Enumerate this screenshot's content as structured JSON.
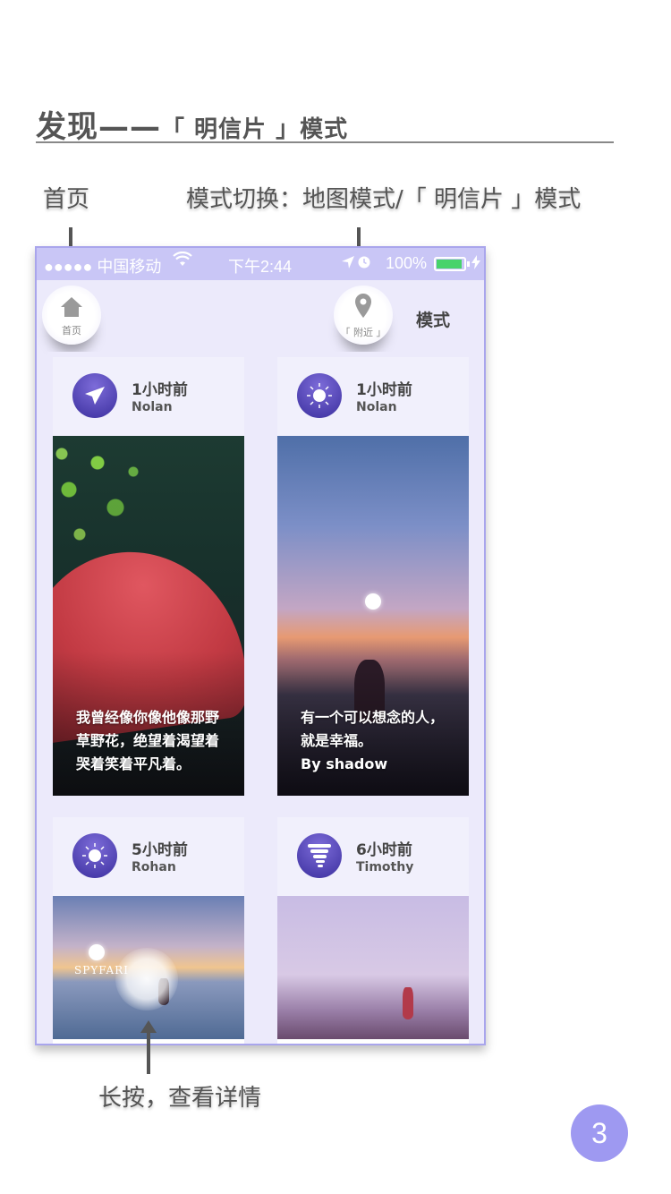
{
  "header": {
    "title_main": "发现——",
    "title_sub": "「 明信片 」模式"
  },
  "annotations": {
    "home": "首页",
    "mode_switch": "模式切换：地图模式/「 明信片 」模式",
    "long_press": "长按，查看详情"
  },
  "status_bar": {
    "carrier": "●●●●● 中国移动",
    "wifi": "wifi-icon",
    "time": "下午2:44",
    "battery": "100%"
  },
  "nav": {
    "home_label": "首页",
    "nearby_label": "「 附近 」",
    "mode_label": "模式"
  },
  "cards": [
    {
      "time": "1小时前",
      "user": "Nolan",
      "avatar_icon": "paper-plane-icon",
      "caption": [
        "我曾经像你像他像那野",
        "草野花，绝望着渴望着",
        "哭着笑着平凡着。"
      ]
    },
    {
      "time": "1小时前",
      "user": "Nolan",
      "avatar_icon": "sun-icon",
      "caption": [
        "有一个可以想念的人，",
        "就是幸福。",
        "By shadow"
      ]
    },
    {
      "time": "5小时前",
      "user": "Rohan",
      "avatar_icon": "sun-icon",
      "watermark": "SPYFARI"
    },
    {
      "time": "6小时前",
      "user": "Timothy",
      "avatar_icon": "tornado-icon"
    }
  ],
  "page_number": "3",
  "colors": {
    "accent": "#9e99f1",
    "status_bar": "#c9c6f6",
    "list_bg": "#eceafb"
  }
}
